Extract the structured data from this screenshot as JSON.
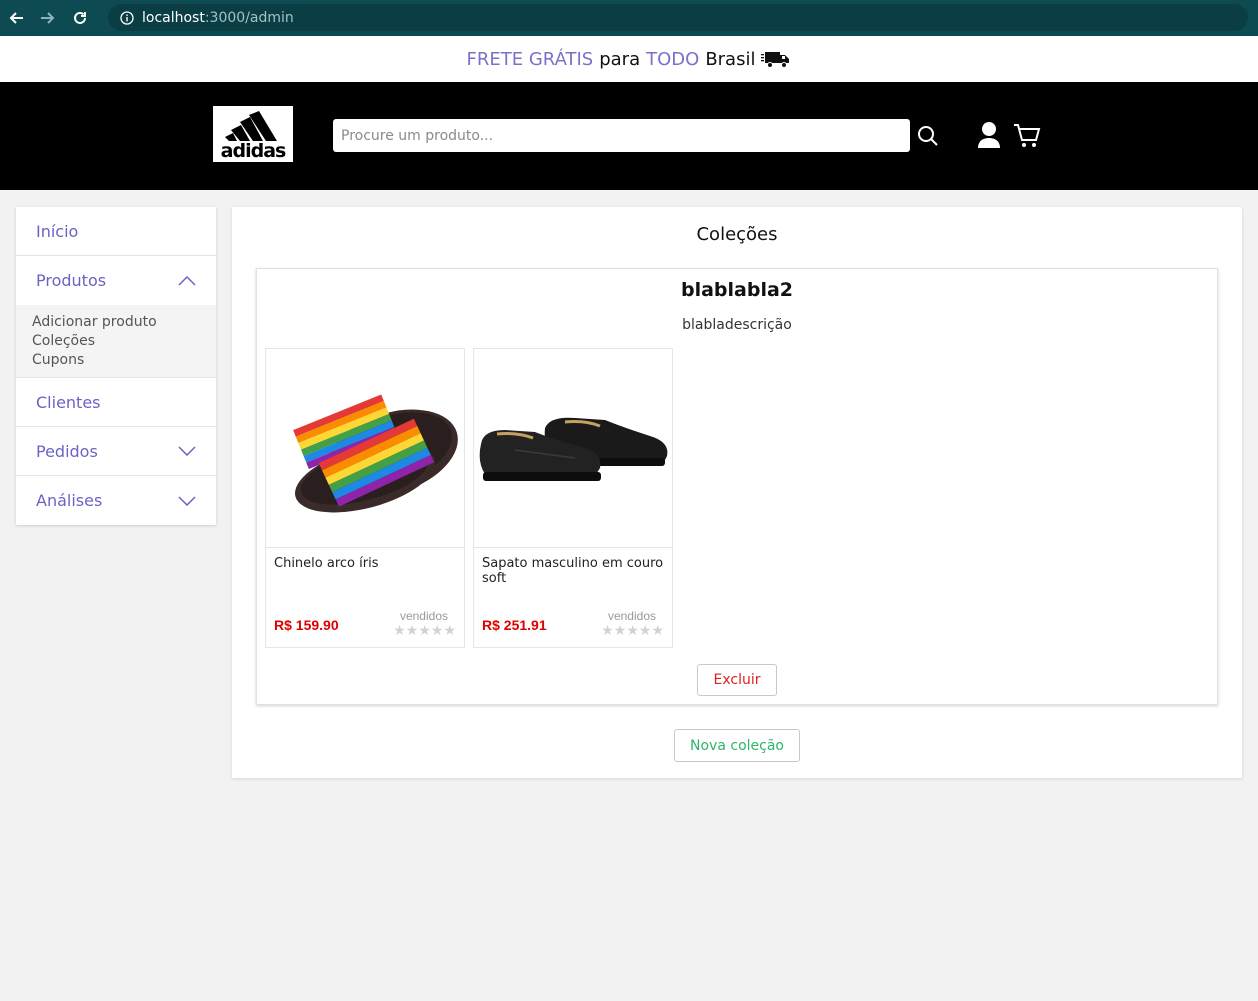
{
  "browser": {
    "url_host": "localhost",
    "url_path": ":3000/admin"
  },
  "promo": {
    "part1": "FRETE GRÁTIS",
    "part2": "para",
    "part3": "TODO",
    "part4": "Brasil"
  },
  "header": {
    "logo_text": "adidas",
    "search_placeholder": "Procure um produto..."
  },
  "sidebar": {
    "items": [
      {
        "label": "Início"
      },
      {
        "label": "Produtos"
      },
      {
        "label": "Clientes"
      },
      {
        "label": "Pedidos"
      },
      {
        "label": "Análises"
      }
    ],
    "produtos_sub": [
      "Adicionar produto",
      "Coleções",
      "Cupons"
    ]
  },
  "main": {
    "title": "Coleções",
    "new_collection_label": "Nova coleção",
    "collection": {
      "name": "blablabla2",
      "description": "blabladescrição",
      "delete_label": "Excluir",
      "products": [
        {
          "name": "Chinelo arco íris",
          "price": "R$ 159.90",
          "sold": "vendidos",
          "stars": "★★★★★"
        },
        {
          "name": "Sapato masculino em couro soft",
          "price": "R$ 251.91",
          "sold": "vendidos",
          "stars": "★★★★★"
        }
      ]
    }
  },
  "colors": {
    "header_bg": "#000000",
    "accent_purple": "#7a72c9",
    "price_red": "#e00000",
    "delete_red": "#e02020",
    "new_green": "#2db56a",
    "browser_bar": "#0d4a52"
  }
}
